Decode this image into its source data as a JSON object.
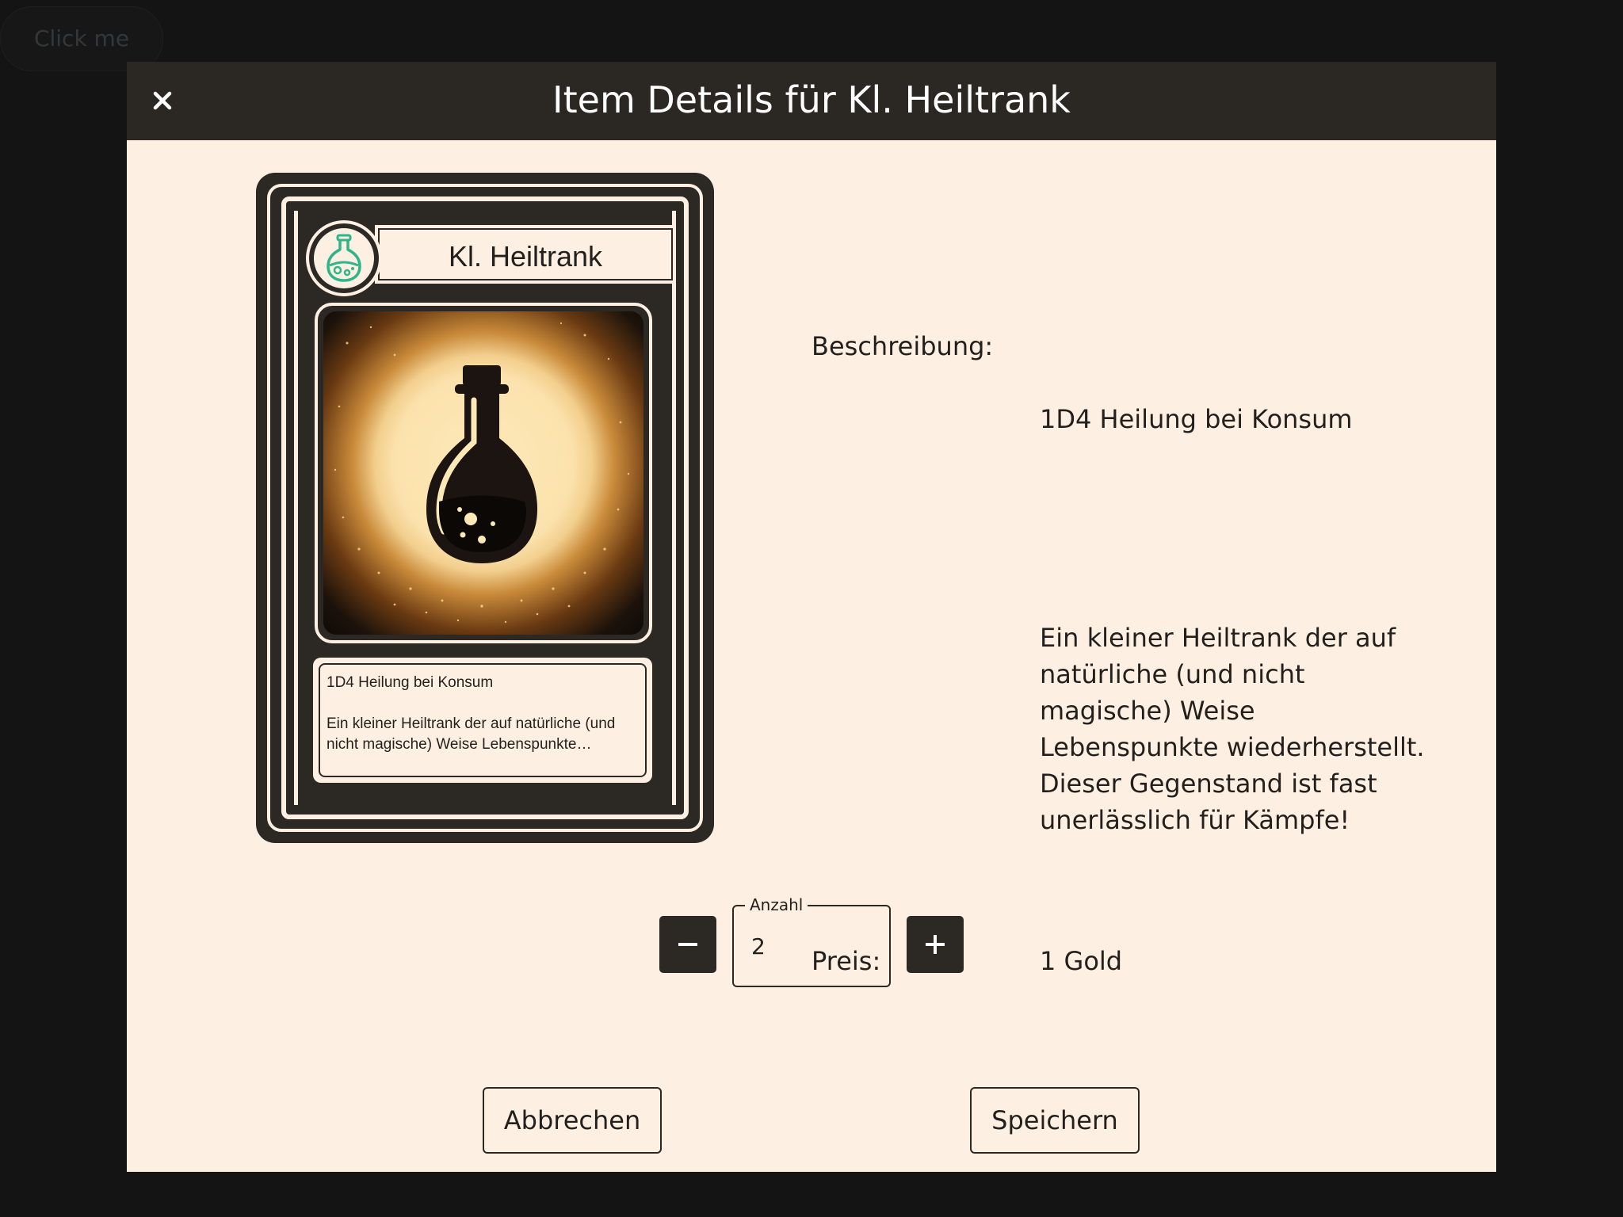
{
  "background": {
    "button_label": "Click me"
  },
  "dialog": {
    "title": "Item Details für Kl. Heiltrank",
    "close_icon": "close-icon"
  },
  "card": {
    "name": "Kl. Heiltrank",
    "icon": "potion-icon",
    "image": "potion-bottle-illustration",
    "short_text": "1D4 Heilung bei Konsum",
    "long_text": "Ein kleiner Heiltrank der auf natürliche (und nicht magische) Weise Lebenspunkte wiederherstellt."
  },
  "details": {
    "description_label": "Beschreibung:",
    "description_short": "1D4 Heilung bei Konsum",
    "description_long": "Ein kleiner Heiltrank der auf natürliche (und nicht magische) Weise Lebenspunkte wiederherstellt.\nDieser Gegenstand ist fast unerlässlich für Kämpfe!",
    "price_label": "Preis:",
    "price_value": "1 Gold"
  },
  "quantity": {
    "label": "Anzahl",
    "value": "2",
    "decrement_icon": "minus-icon",
    "increment_icon": "plus-icon"
  },
  "actions": {
    "cancel_label": "Abbrechen",
    "save_label": "Speichern"
  },
  "colors": {
    "header": "#2b2824",
    "dialog_bg": "#fdf0e3",
    "card_dark": "#2c2925",
    "potion_icon": "#2fb589"
  }
}
